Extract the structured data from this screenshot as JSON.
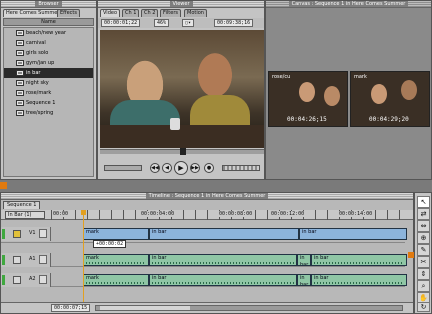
{
  "browser": {
    "title": "Browser",
    "tabs": [
      "Here Comes Summer",
      "Effects"
    ],
    "column_header": "Name",
    "items": [
      "beach/new year",
      "carnival",
      "girls solo",
      "gym/jan up",
      "in bar",
      "night sky",
      "rose/mark",
      "Sequence 1",
      "tree/spring"
    ],
    "selected_index": 4
  },
  "viewer": {
    "title": "Viewer",
    "tabs": [
      "Video",
      "Ch 1",
      "Ch 2",
      "Filters",
      "Motion"
    ],
    "duration_tc": "00:00:01;22",
    "zoom": "46%",
    "current_tc": "00:09:38;16",
    "transport": [
      "◀◀",
      "◀",
      "▶",
      "▶▶",
      "●"
    ]
  },
  "canvas": {
    "title": "Canvas : Sequence 1 in Here Comes Summer",
    "thumb_left": {
      "label": "rose/cu",
      "timecode": "00:04:26;15"
    },
    "thumb_right": {
      "label": "mark",
      "timecode": "00:04:29;20"
    }
  },
  "timeline": {
    "title": "Timeline : Sequence 1 in Here Comes Summer",
    "tab": "Sequence 1",
    "target": "In Bar (1)",
    "ruler_labels": [
      "00:00",
      "00:00:04:00",
      "00:00:08:00",
      "00:00:12:00",
      "00:00:14:00"
    ],
    "tracks": [
      {
        "name": "V1",
        "clips": [
          "mark",
          "in bar",
          "in bar"
        ]
      },
      {
        "name": "A1",
        "clips": [
          "mark",
          "in bar",
          "in bar",
          "in bar"
        ]
      },
      {
        "name": "A2",
        "clips": [
          "mark",
          "in bar",
          "in bar",
          "in bar"
        ]
      }
    ],
    "tooltip": "+00:00:02",
    "footer_tc": "00:00:07;15"
  },
  "tools": [
    "↖",
    "⇄",
    "⇔",
    "⊕",
    "✎",
    "✂",
    "⇕",
    "⌕",
    "✋",
    "↻"
  ]
}
